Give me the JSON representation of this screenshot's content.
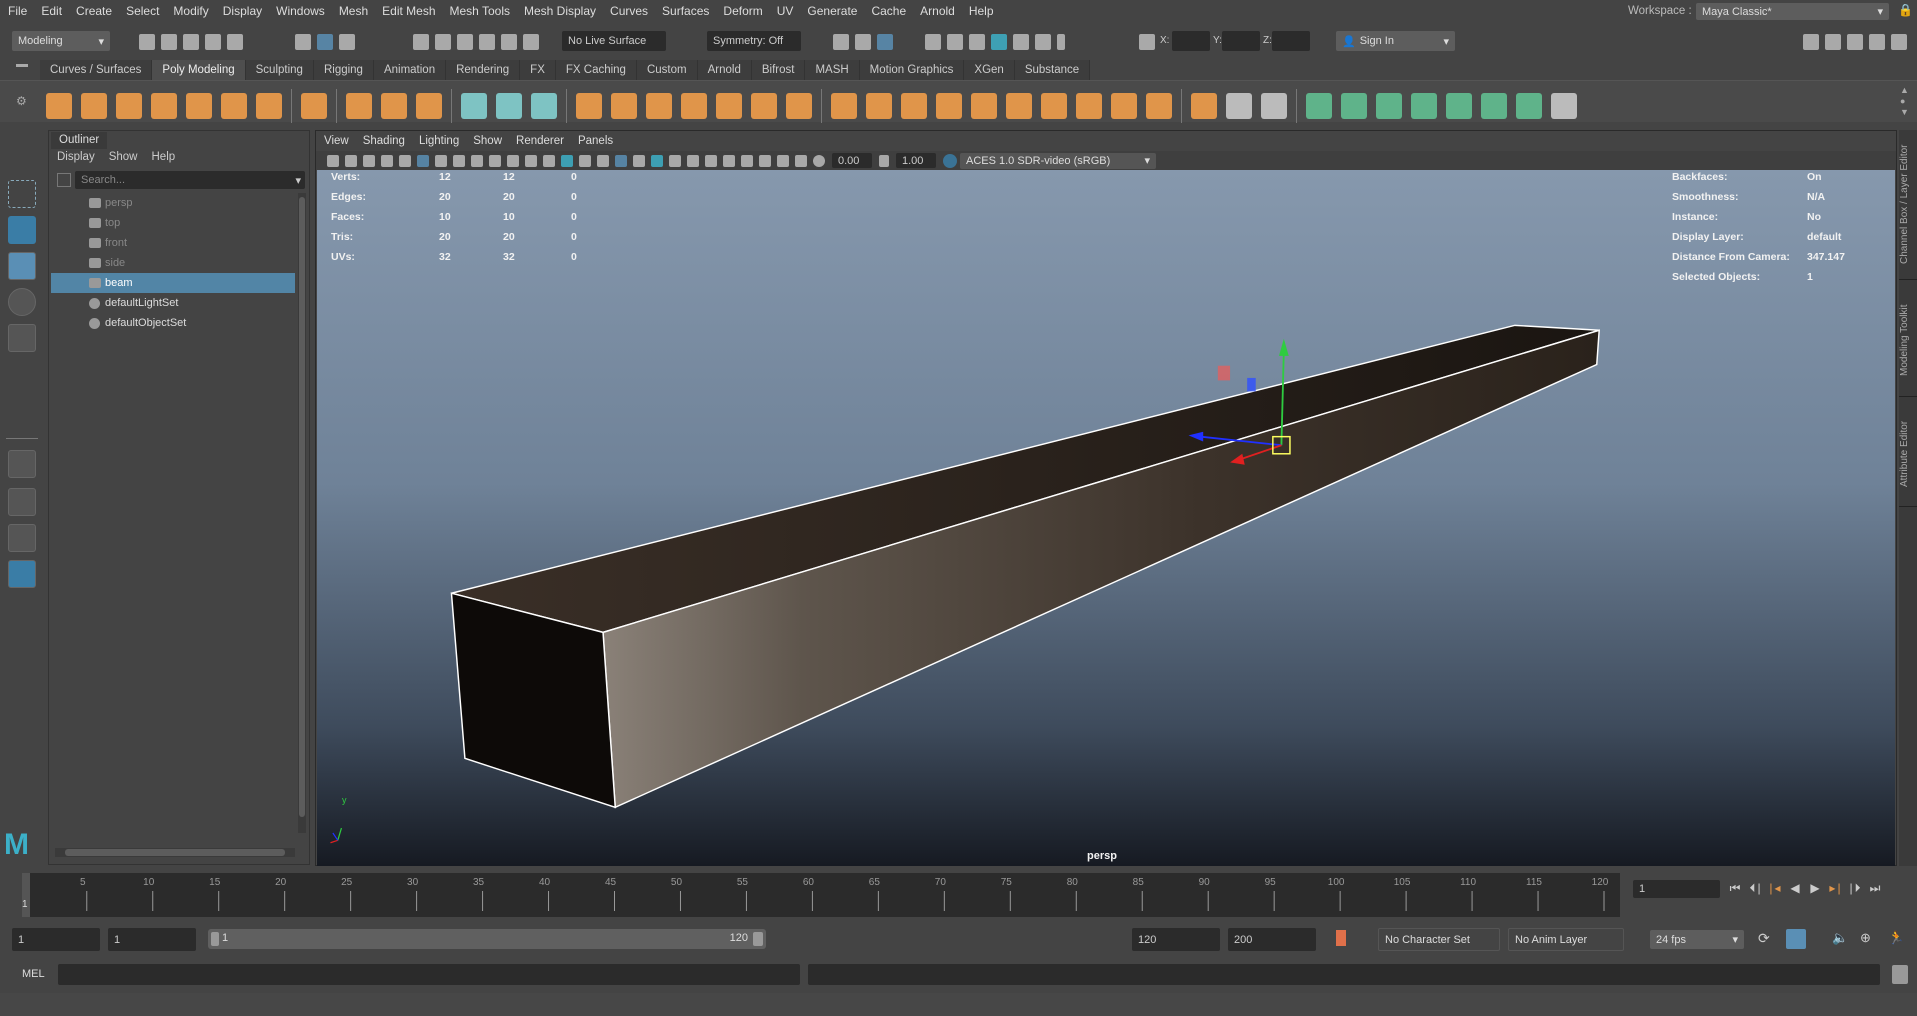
{
  "menubar": [
    "File",
    "Edit",
    "Create",
    "Select",
    "Modify",
    "Display",
    "Windows",
    "Mesh",
    "Edit Mesh",
    "Mesh Tools",
    "Mesh Display",
    "Curves",
    "Surfaces",
    "Deform",
    "UV",
    "Generate",
    "Cache",
    "Arnold",
    "Help"
  ],
  "workspace": {
    "label": "Workspace :",
    "value": "Maya Classic*"
  },
  "statusline": {
    "menuset": "Modeling",
    "live_surface": "No Live Surface",
    "symmetry": "Symmetry: Off",
    "x_label": "X:",
    "y_label": "Y:",
    "z_label": "Z:",
    "sign_in": "Sign In"
  },
  "shelf": {
    "tabs": [
      "Curves / Surfaces",
      "Poly Modeling",
      "Sculpting",
      "Rigging",
      "Animation",
      "Rendering",
      "FX",
      "FX Caching",
      "Custom",
      "Arnold",
      "Bifrost",
      "MASH",
      "Motion Graphics",
      "XGen",
      "Substance"
    ],
    "active_tab": 1,
    "icons": [
      {
        "name": "poly-sphere-icon",
        "c": "#e0954a"
      },
      {
        "name": "poly-cube-icon",
        "c": "#e0954a"
      },
      {
        "name": "poly-cylinder-icon",
        "c": "#e0954a"
      },
      {
        "name": "poly-cone-icon",
        "c": "#e0954a"
      },
      {
        "name": "poly-torus-icon",
        "c": "#e0954a"
      },
      {
        "name": "poly-diamond-icon",
        "c": "#e0954a"
      },
      {
        "name": "poly-disc-icon",
        "c": "#e0954a"
      },
      {
        "sep": true
      },
      {
        "name": "platonic-solid-icon",
        "c": "#e0954a"
      },
      {
        "sep": true
      },
      {
        "name": "super-shape-icon",
        "c": "#e0954a"
      },
      {
        "name": "type-text-icon",
        "c": "#e0954a"
      },
      {
        "name": "svg-icon",
        "c": "#e0954a"
      },
      {
        "sep": true
      },
      {
        "name": "center-pivot-icon",
        "c": "#7ec3c3"
      },
      {
        "name": "delete-history-icon",
        "c": "#7ec3c3"
      },
      {
        "name": "freeze-transform-icon",
        "c": "#7ec3c3"
      },
      {
        "sep": true
      },
      {
        "name": "combine-icon",
        "c": "#e0954a"
      },
      {
        "name": "separate-icon",
        "c": "#e0954a"
      },
      {
        "name": "mirror-icon",
        "c": "#e0954a"
      },
      {
        "name": "smooth-icon",
        "c": "#e0954a"
      },
      {
        "name": "reduce-icon",
        "c": "#e0954a"
      },
      {
        "name": "remesh-icon",
        "c": "#e0954a"
      },
      {
        "name": "retopo-icon",
        "c": "#e0954a"
      },
      {
        "sep": true
      },
      {
        "name": "extrude-icon",
        "c": "#e0954a"
      },
      {
        "name": "bridge-icon",
        "c": "#e0954a"
      },
      {
        "name": "bevel-icon",
        "c": "#e0954a"
      },
      {
        "name": "append-polygon-icon",
        "c": "#e0954a"
      },
      {
        "name": "fill-hole-icon",
        "c": "#e0954a"
      },
      {
        "name": "wedge-icon",
        "c": "#e0954a"
      },
      {
        "name": "poke-icon",
        "c": "#e0954a"
      },
      {
        "name": "circularize-icon",
        "c": "#e0954a"
      },
      {
        "name": "collapse-icon",
        "c": "#e0954a"
      },
      {
        "name": "merge-icon",
        "c": "#e0954a"
      },
      {
        "sep": true
      },
      {
        "name": "multi-cut-icon",
        "c": "#e0954a"
      },
      {
        "name": "edge-loop-icon",
        "c": "#bbbbbb"
      },
      {
        "name": "quad-draw-icon",
        "c": "#bbbbbb"
      },
      {
        "sep": true
      },
      {
        "name": "planar-uv-icon",
        "c": "#5fb38a"
      },
      {
        "name": "cylindrical-uv-icon",
        "c": "#5fb38a"
      },
      {
        "name": "spherical-uv-icon",
        "c": "#5fb38a"
      },
      {
        "name": "automatic-uv-icon",
        "c": "#5fb38a"
      },
      {
        "name": "unfold-uv-icon",
        "c": "#5fb38a"
      },
      {
        "name": "uv-editor-icon",
        "c": "#5fb38a"
      },
      {
        "name": "cut-uv-icon",
        "c": "#5fb38a"
      },
      {
        "name": "sew-uv-icon",
        "c": "#bbbbbb"
      }
    ]
  },
  "outliner": {
    "title": "Outliner",
    "menu": [
      "Display",
      "Show",
      "Help"
    ],
    "search_placeholder": "Search...",
    "items": [
      {
        "label": "persp",
        "icon": "camera-icon",
        "dim": true
      },
      {
        "label": "top",
        "icon": "camera-icon",
        "dim": true
      },
      {
        "label": "front",
        "icon": "camera-icon",
        "dim": true
      },
      {
        "label": "side",
        "icon": "camera-icon",
        "dim": true
      },
      {
        "label": "beam",
        "icon": "mesh-transform-icon",
        "selected": true
      },
      {
        "label": "defaultLightSet",
        "icon": "set-icon"
      },
      {
        "label": "defaultObjectSet",
        "icon": "set-icon"
      }
    ]
  },
  "viewport": {
    "menu": [
      "View",
      "Shading",
      "Lighting",
      "Show",
      "Renderer",
      "Panels"
    ],
    "exposure": "0.00",
    "gamma": "1.00",
    "color_space": "ACES 1.0 SDR-video (sRGB)",
    "camera": "persp",
    "hud_left": [
      [
        "Verts:",
        "12",
        "12",
        "0"
      ],
      [
        "Edges:",
        "20",
        "20",
        "0"
      ],
      [
        "Faces:",
        "10",
        "10",
        "0"
      ],
      [
        "Tris:",
        "20",
        "20",
        "0"
      ],
      [
        "UVs:",
        "32",
        "32",
        "0"
      ]
    ],
    "hud_right": [
      [
        "Backfaces:",
        "On"
      ],
      [
        "Smoothness:",
        "N/A"
      ],
      [
        "Instance:",
        "No"
      ],
      [
        "Display Layer:",
        "default"
      ],
      [
        "Distance From Camera:",
        "347.147"
      ],
      [
        "Selected Objects:",
        "1"
      ]
    ],
    "axis_y": "y"
  },
  "right_tabs": [
    "Channel Box / Layer Editor",
    "Modeling Toolkit",
    "Attribute Editor"
  ],
  "timeline": {
    "start": 1,
    "end": 120,
    "current": 1,
    "labels": [
      "5",
      "10",
      "15",
      "20",
      "25",
      "30",
      "35",
      "40",
      "45",
      "50",
      "55",
      "60",
      "65",
      "70",
      "75",
      "80",
      "85",
      "90",
      "95",
      "100",
      "105",
      "110",
      "115",
      "120"
    ],
    "current_label": "1",
    "current_field": "1"
  },
  "range": {
    "start": "1",
    "playback_start": "1",
    "slider_start": "1",
    "slider_end": "120",
    "playback_end": "120",
    "end": "200",
    "character_set": "No Character Set",
    "anim_layer": "No Anim Layer",
    "fps": "24 fps"
  },
  "command": {
    "lang": "MEL"
  }
}
